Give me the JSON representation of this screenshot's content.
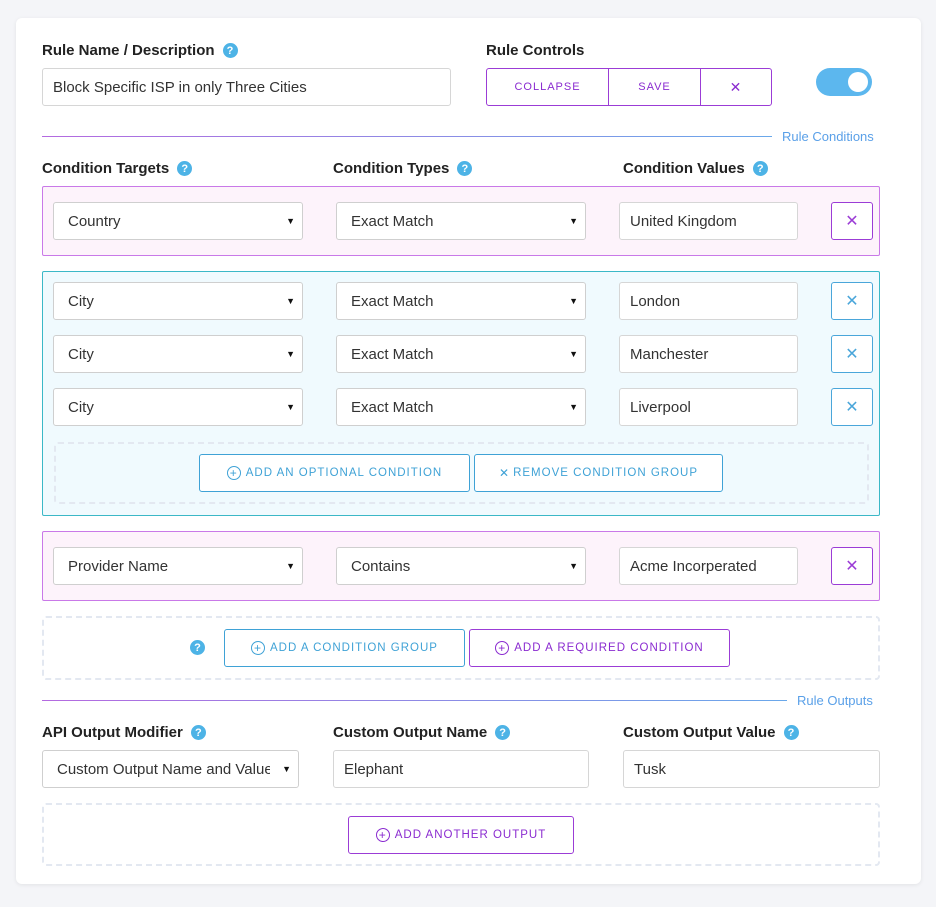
{
  "header": {
    "rule_name_label": "Rule Name / Description",
    "rule_name_value": "Block Specific ISP in only Three Cities",
    "rule_controls_label": "Rule Controls",
    "collapse_label": "COLLAPSE",
    "save_label": "SAVE",
    "close_glyph": "✕",
    "toggle_on": true
  },
  "conditions": {
    "section_label": "Rule Conditions",
    "targets_label": "Condition Targets",
    "types_label": "Condition Types",
    "values_label": "Condition Values",
    "group1": {
      "target": "Country",
      "type": "Exact Match",
      "value": "United Kingdom"
    },
    "group2": {
      "rows": [
        {
          "target": "City",
          "type": "Exact Match",
          "value": "London"
        },
        {
          "target": "City",
          "type": "Exact Match",
          "value": "Manchester"
        },
        {
          "target": "City",
          "type": "Exact Match",
          "value": "Liverpool"
        }
      ],
      "add_optional_label": "ADD AN OPTIONAL CONDITION",
      "remove_group_label": "REMOVE CONDITION GROUP"
    },
    "group3": {
      "target": "Provider Name",
      "type": "Contains",
      "value": "Acme Incorperated"
    },
    "add_group_label": "ADD A CONDITION GROUP",
    "add_required_label": "ADD A REQUIRED CONDITION"
  },
  "outputs": {
    "section_label": "Rule Outputs",
    "modifier_label": "API Output Modifier",
    "modifier_value": "Custom Output Name and Value",
    "name_label": "Custom Output Name",
    "name_value": "Elephant",
    "value_label": "Custom Output Value",
    "value_value": "Tusk",
    "add_output_label": "ADD ANOTHER OUTPUT"
  },
  "icons": {
    "help": "?",
    "caret": "▼",
    "close": "✕",
    "plus": "+"
  },
  "colors": {
    "accent_purple": "#9b3cd6",
    "accent_blue": "#3fa2d6",
    "help_blue": "#4db3e6",
    "toggle_blue": "#5cb7ee"
  }
}
